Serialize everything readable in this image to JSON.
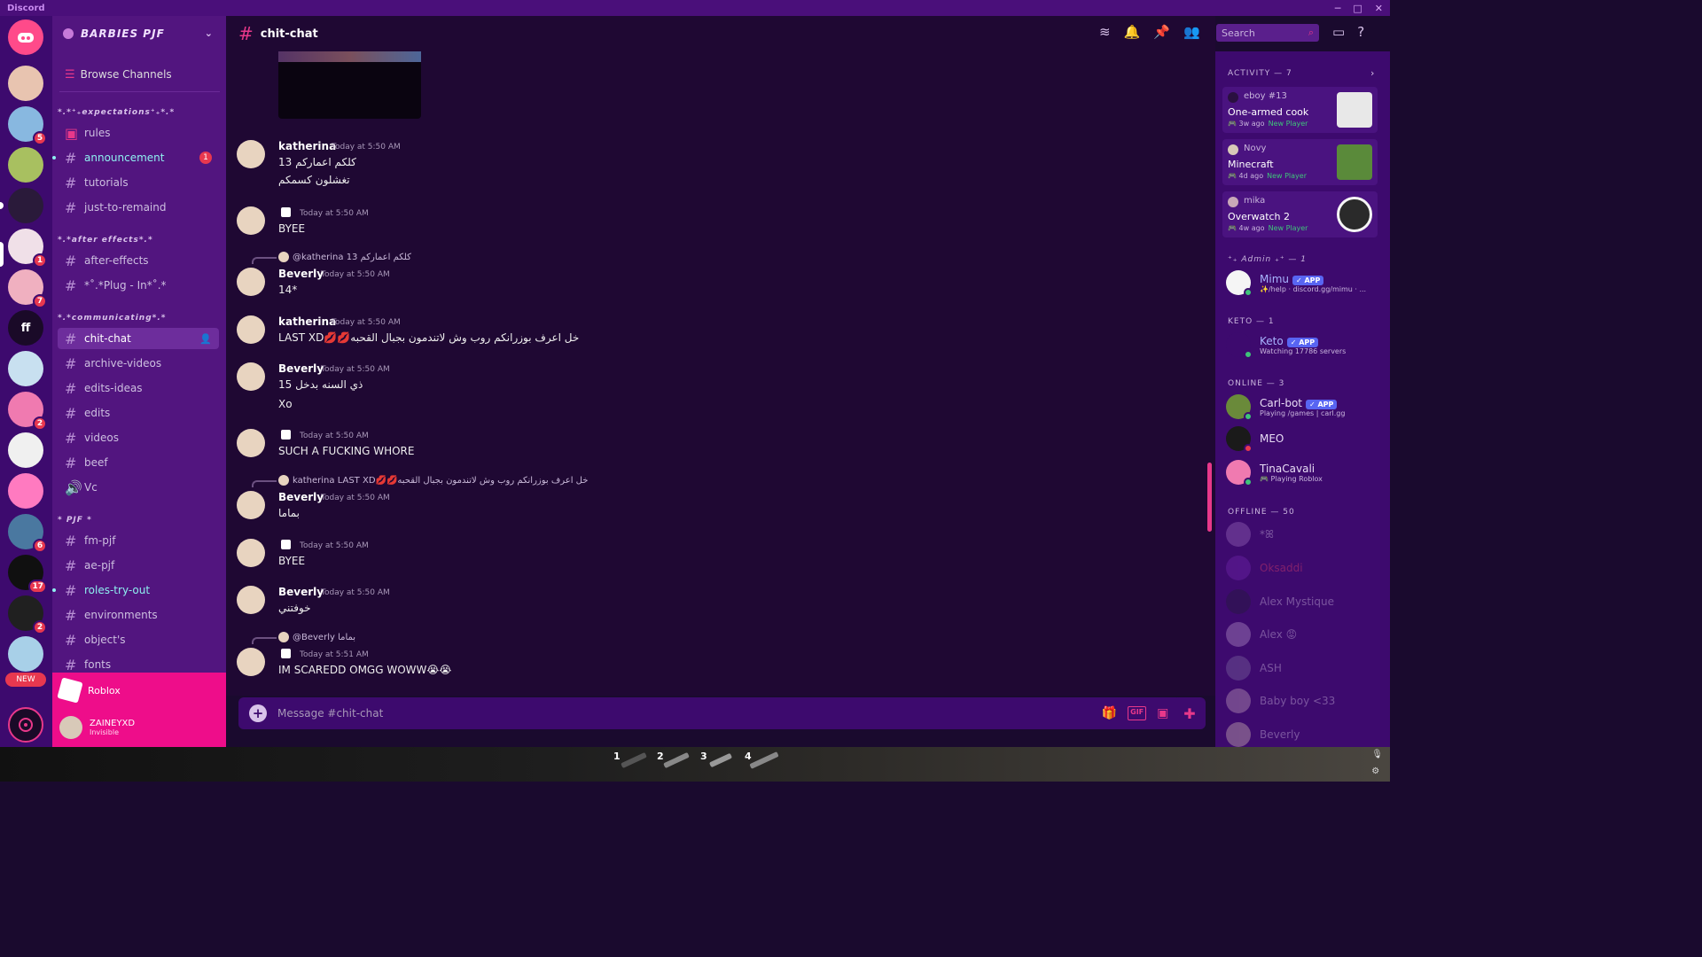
{
  "window": {
    "title": "Discord",
    "controls": [
      "─",
      "□",
      "✕"
    ]
  },
  "server": {
    "name": "BARBIES PJF",
    "browse_label": "Browse Channels"
  },
  "server_badges": [
    "5",
    "1",
    "7",
    "2",
    "6",
    "17",
    "2"
  ],
  "server_labels": {
    "ff": "ff",
    "new": "NEW"
  },
  "categories": [
    {
      "label": "*.*⁺₊expectations⁺₊*.*",
      "channels": [
        "rules",
        "announcement",
        "tutorials",
        "just-to-remaind"
      ]
    },
    {
      "label": "*.*after effects*.*",
      "channels": [
        "after-effects",
        "*˚.*Plug - In*˚.*"
      ]
    },
    {
      "label": "*.*communicating*.*",
      "channels": [
        "chit-chat",
        "archive-videos",
        "edits-ideas",
        "edits",
        "videos",
        "beef",
        "Vc"
      ]
    },
    {
      "label": "* PJF *",
      "channels": [
        "fm-pjf",
        "ae-pjf",
        "roles-try-out",
        "environments",
        "object's",
        "fonts"
      ]
    }
  ],
  "announcement_badge": "1",
  "activity_game": "Roblox",
  "user": {
    "name": "ZAINEYXD",
    "status": "Invisible"
  },
  "chat": {
    "channel": "chit-chat",
    "messages": [
      {
        "author": "katherina",
        "time": "Today at 5:50 AM",
        "lines": [
          "كلكم اعماركم 13",
          "تغشلون كسمكم"
        ]
      },
      {
        "author": "",
        "time": "Today at 5:50 AM",
        "lines": [
          "BYEE"
        ]
      },
      {
        "reply": "@katherina 13 كلكم اعماركم",
        "author": "Beverly",
        "time": "Today at 5:50 AM",
        "lines": [
          "14*"
        ]
      },
      {
        "author": "katherina",
        "time": "Today at 5:50 AM",
        "lines": [
          "LAST XD💋💋خل اعرف بوزرانكم روب وش لاتندمون بجبال القحبه"
        ]
      },
      {
        "author": "Beverly",
        "time": "Today at 5:50 AM",
        "lines": [
          "ذي السنه بدخل 15",
          "Xo"
        ]
      },
      {
        "author": "",
        "time": "Today at 5:50 AM",
        "lines": [
          "SUCH A FUCKING WHORE"
        ]
      },
      {
        "reply": "katherina LAST XD💋💋خل اعرف بوزرانكم روب وش لاتندمون بجبال القحبه",
        "author": "Beverly",
        "time": "Today at 5:50 AM",
        "lines": [
          "بماما"
        ]
      },
      {
        "author": "",
        "time": "Today at 5:50 AM",
        "lines": [
          "BYEE"
        ]
      },
      {
        "author": "Beverly",
        "time": "Today at 5:50 AM",
        "lines": [
          "خوفتني"
        ]
      },
      {
        "reply": "@Beverly بماما",
        "author": "",
        "time": "Today at 5:51 AM",
        "lines": [
          "IM SCAREDD OMGG WOWW😭😭"
        ]
      }
    ],
    "composer_placeholder": "Message #chit-chat"
  },
  "search_placeholder": "Search",
  "members": {
    "activity_header": "ACTIVITY — 7",
    "activities": [
      {
        "user": "eboy #13",
        "game": "One-armed cook",
        "ago": "3w ago",
        "tag": "New Player",
        "thumb_color": "#222222"
      },
      {
        "user": "Novy",
        "game": "Minecraft",
        "ago": "4d ago",
        "tag": "New Player",
        "thumb_color": "#5a8a3a"
      },
      {
        "user": "mika",
        "game": "Overwatch 2",
        "ago": "4w ago",
        "tag": "New Player",
        "thumb_color": "#333333"
      }
    ],
    "admin_header": "⁺₊ Admin ₊⁺ — 1",
    "admin": [
      {
        "name": "Mimu",
        "app": "✓ APP",
        "sub": "✨/help · discord.gg/mimu · ..."
      }
    ],
    "keto_header": "KETO — 1",
    "keto": [
      {
        "name": "Keto",
        "app": "✓ APP",
        "sub": "Watching 17786 servers"
      }
    ],
    "online_header": "ONLINE — 3",
    "online": [
      {
        "name": "Carl-bot",
        "app": "✓ APP",
        "sub": "Playing /games | carl.gg"
      },
      {
        "name": "MEO",
        "sub": ""
      },
      {
        "name": "TinaCavali",
        "sub": "Playing Roblox"
      }
    ],
    "offline_header": "OFFLINE — 50",
    "offline": [
      "*ꕤ",
      "Oksaddi",
      "Alex Mystique",
      "Alex 😡",
      "ASH",
      "Baby boy <33",
      "Beverly"
    ]
  },
  "game_hotbar": [
    "1",
    "2",
    "3",
    "4"
  ],
  "colors": {
    "accent": "#e8388a",
    "rail": "#3d0a6e",
    "sidebar": "#52157f",
    "chat": "#1f0833"
  }
}
